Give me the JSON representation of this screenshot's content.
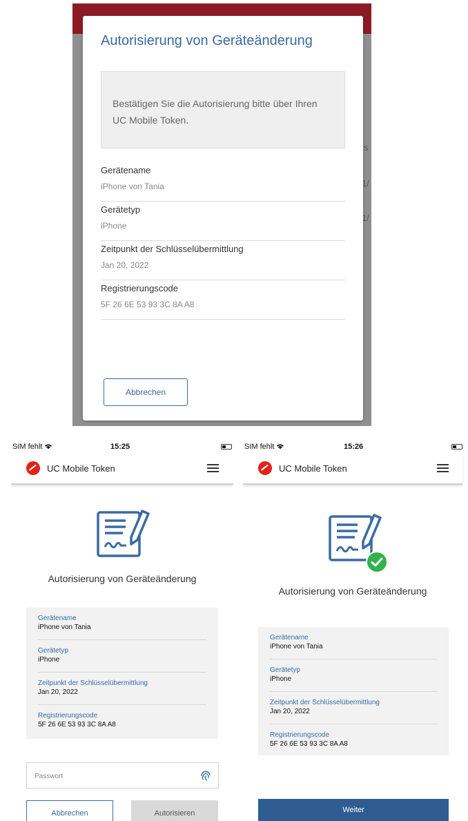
{
  "desktop_dialog": {
    "title": "Autorisierung von Geräteänderung",
    "info_text": "Bestätigen Sie die Autorisierung bitte über Ihren UC Mobile Token.",
    "fields": [
      {
        "label": "Gerätename",
        "value": "iPhone von Tania"
      },
      {
        "label": "Gerätetyp",
        "value": "iPhone"
      },
      {
        "label": "Zeitpunkt der Schlüsselübermittlung",
        "value": "Jan 20, 2022"
      },
      {
        "label": "Registrierungscode",
        "value": "5F 26 6E 53 93 3C 8A A8"
      }
    ],
    "cancel_label": "Abbrechen",
    "background_fragments": [
      "is",
      "1/",
      "1/"
    ]
  },
  "phone_left": {
    "status": {
      "carrier": "SIM fehlt",
      "time": "15:25"
    },
    "app_name": "UC Mobile Token",
    "title": "Autorisierung von Geräteänderung",
    "fields": [
      {
        "label": "Gerätename",
        "value": "iPhone von Tania"
      },
      {
        "label": "Gerätetyp",
        "value": "iPhone"
      },
      {
        "label": "Zeitpunkt der Schlüsselübermittlung",
        "value": "Jan 20, 2022"
      },
      {
        "label": "Registrierungscode",
        "value": "5F 26 6E 53 93 3C 8A A8"
      }
    ],
    "password_placeholder": "Passwort",
    "cancel_label": "Abbrechen",
    "authorize_label": "Autorisieren"
  },
  "phone_right": {
    "status": {
      "carrier": "SIM fehlt",
      "time": "15:26"
    },
    "app_name": "UC Mobile Token",
    "title": "Autorisierung von Geräteänderung",
    "fields": [
      {
        "label": "Gerätename",
        "value": "iPhone von Tania"
      },
      {
        "label": "Gerätetyp",
        "value": "iPhone"
      },
      {
        "label": "Zeitpunkt der Schlüsselübermittlung",
        "value": "Jan 20, 2022"
      },
      {
        "label": "Registrierungscode",
        "value": "5F 26 6E 53 93 3C 8A A8"
      }
    ],
    "continue_label": "Weiter"
  },
  "icons": {
    "logo": "unicredit-logo-icon",
    "menu": "hamburger-menu-icon",
    "document": "signed-document-icon",
    "fingerprint": "fingerprint-icon",
    "success": "checkmark-circle-icon",
    "wifi": "wifi-icon",
    "battery": "battery-icon"
  },
  "colors": {
    "brand_red": "#e2231a",
    "accent_blue": "#3a6aa3",
    "success_green": "#2fb34a",
    "primary_button": "#2f5d92"
  }
}
